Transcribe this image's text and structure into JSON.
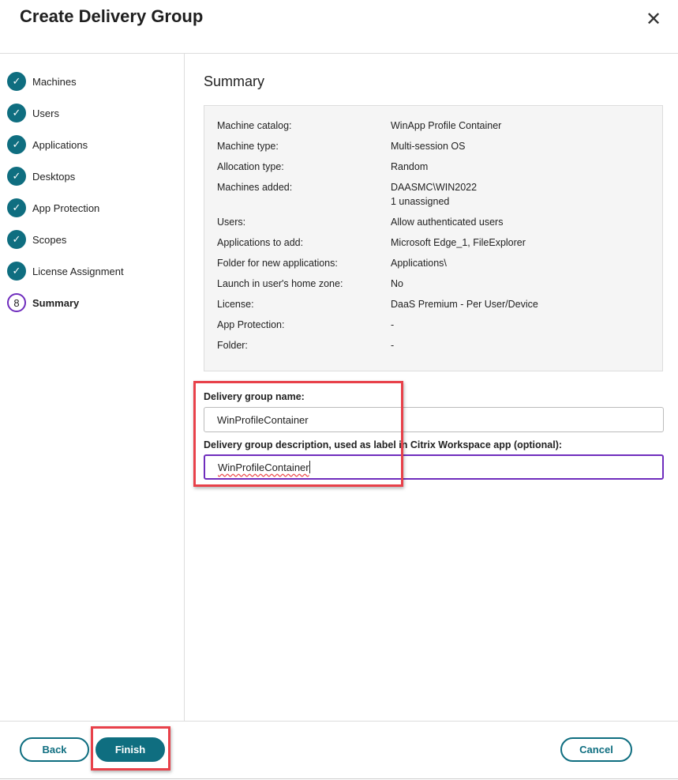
{
  "dialog": {
    "title": "Create Delivery Group",
    "close_icon": "close-icon"
  },
  "steps": [
    {
      "label": "Machines",
      "status": "done"
    },
    {
      "label": "Users",
      "status": "done"
    },
    {
      "label": "Applications",
      "status": "done"
    },
    {
      "label": "Desktops",
      "status": "done"
    },
    {
      "label": "App Protection",
      "status": "done"
    },
    {
      "label": "Scopes",
      "status": "done"
    },
    {
      "label": "License Assignment",
      "status": "done"
    },
    {
      "label": "Summary",
      "status": "current",
      "number": "8"
    }
  ],
  "summary": {
    "title": "Summary",
    "rows": [
      {
        "label": "Machine catalog:",
        "value": "WinApp Profile Container"
      },
      {
        "label": "Machine type:",
        "value": "Multi-session OS"
      },
      {
        "label": "Allocation type:",
        "value": "Random"
      },
      {
        "label": "Machines added:",
        "value": "DAASMC\\WIN2022",
        "value2": "1 unassigned"
      },
      {
        "label": "Users:",
        "value": "Allow authenticated users"
      },
      {
        "label": "Applications to add:",
        "value": "Microsoft Edge_1, FileExplorer"
      },
      {
        "label": "Folder for new applications:",
        "value": "Applications\\"
      },
      {
        "label": "Launch in user's home zone:",
        "value": "No"
      },
      {
        "label": "License:",
        "value": "DaaS Premium - Per User/Device"
      },
      {
        "label": "App Protection:",
        "value": "-"
      },
      {
        "label": "Folder:",
        "value": "-"
      }
    ]
  },
  "form": {
    "name_label": "Delivery group name:",
    "name_value": "WinProfileContainer",
    "desc_label": "Delivery group description, used as label in Citrix Workspace app (optional):",
    "desc_value": "WinProfileContainer"
  },
  "footer": {
    "back": "Back",
    "finish": "Finish",
    "cancel": "Cancel"
  },
  "colors": {
    "accent": "#0f6e80",
    "focus": "#6f2dbd",
    "highlight": "#e8414a"
  }
}
